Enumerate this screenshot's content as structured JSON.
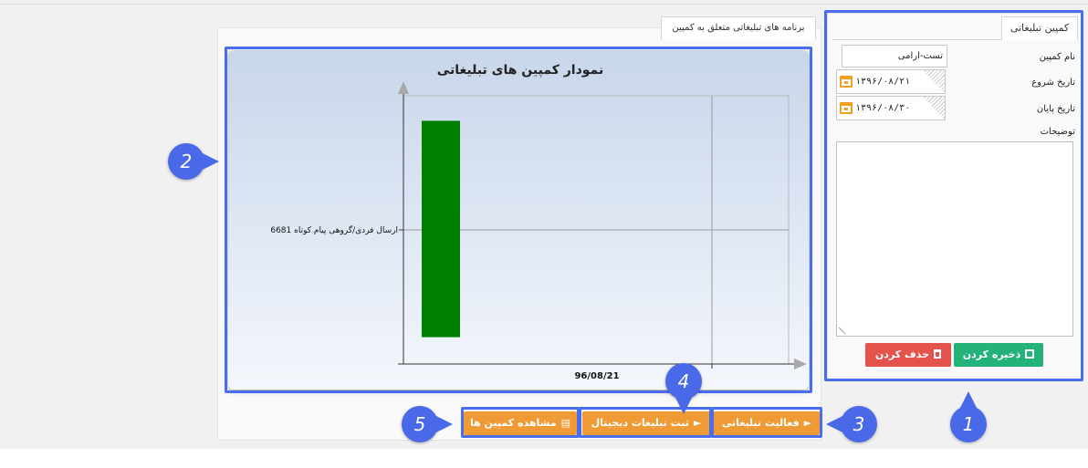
{
  "campaign_form": {
    "tab_label": "کمپین تبلیغاتی",
    "name_label": "نام کمپین",
    "name_value": "تست-ارامی",
    "start_label": "تاریخ شروع",
    "start_value": "۱۳۹۶/۰۸/۲۱",
    "end_label": "تاریخ پایان",
    "end_value": "۱۳۹۶/۰۸/۳۰",
    "desc_label": "توضیحات",
    "desc_value": "",
    "save_label": "ذخیره کردن",
    "delete_label": "حذف کردن"
  },
  "programs": {
    "tab_label": "برنامه های تبلیغاتی متعلق به کمپین"
  },
  "chart_data": {
    "type": "bar",
    "orientation": "horizontal",
    "title": "نمودار کمپین های تبلیغاتی",
    "categories": [
      "ارسال فردی/گروهی پیام کوتاه 6681"
    ],
    "x_tick_labels": [
      "96/08/21"
    ],
    "series": [
      {
        "values": [
          1
        ],
        "color": "#008000"
      }
    ],
    "grid": true
  },
  "actions": {
    "activity_label": "فعالیت تبلیغاتی",
    "digital_label": "ثبت تبلیغات دیجیتال",
    "view_label": "مشاهده کمپین ها"
  },
  "annotations": [
    "1",
    "2",
    "3",
    "4",
    "5"
  ],
  "colors": {
    "accent": "#4a6cf0",
    "save": "#23b37a",
    "delete": "#e4524c",
    "action": "#ef9a34",
    "bar": "#008000"
  }
}
